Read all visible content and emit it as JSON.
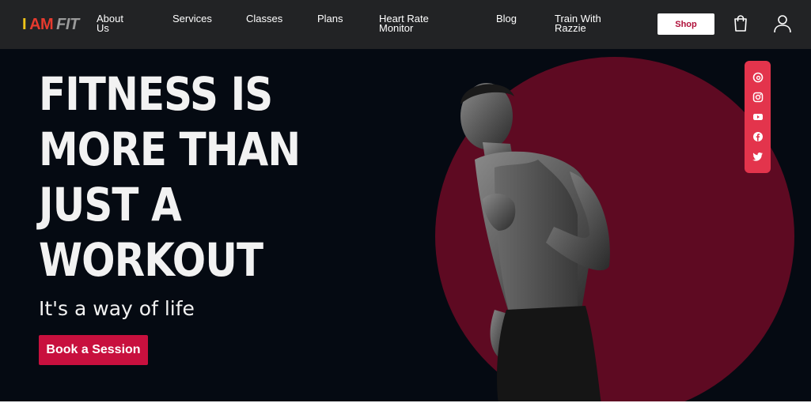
{
  "logo": {
    "part1": "I",
    "part2": "AM",
    "part3": "FIT"
  },
  "nav": {
    "links": [
      {
        "label_line1": "About",
        "label_line2": "Us"
      },
      {
        "label_line1": "Services",
        "label_line2": ""
      },
      {
        "label_line1": "Classes",
        "label_line2": ""
      },
      {
        "label_line1": "Plans",
        "label_line2": ""
      },
      {
        "label_line1": "Heart Rate",
        "label_line2": "Monitor"
      },
      {
        "label_line1": "Blog",
        "label_line2": ""
      },
      {
        "label_line1": "Train With",
        "label_line2": "Razzie"
      }
    ],
    "shop_label": "Shop",
    "icons": [
      "cart-icon",
      "user-icon"
    ]
  },
  "hero": {
    "headline_lines": [
      "FITNESS IS",
      "MORE THAN",
      "JUST A",
      "WORKOUT"
    ],
    "tagline": "It's a way of life",
    "cta_label": "Book a Session"
  },
  "social": {
    "icons": [
      "threads-icon",
      "instagram-icon",
      "youtube-icon",
      "facebook-icon",
      "twitter-icon"
    ]
  },
  "colors": {
    "nav_bg": "#222325",
    "hero_bg": "#050a12",
    "accent": "#c8103e",
    "circle": "#5e0a22",
    "social_bar": "#e3344c",
    "logo_yellow": "#f0c419",
    "logo_red": "#e63a2e"
  }
}
